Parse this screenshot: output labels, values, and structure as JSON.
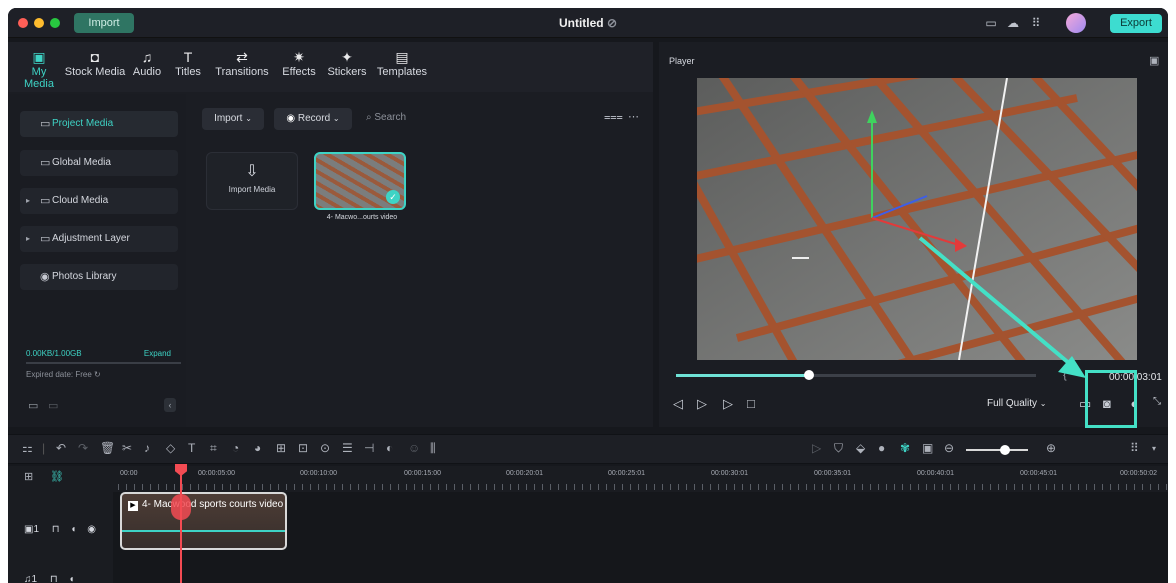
{
  "window": {
    "import_label": "Import",
    "title": "Untitled",
    "export_label": "Export"
  },
  "categories": [
    {
      "label": "My Media",
      "icon": "media-icon",
      "glyph": "▣"
    },
    {
      "label": "Stock Media",
      "icon": "stock-media-icon",
      "glyph": "◘"
    },
    {
      "label": "Audio",
      "icon": "audio-icon",
      "glyph": "♫"
    },
    {
      "label": "Titles",
      "icon": "titles-icon",
      "glyph": "T"
    },
    {
      "label": "Transitions",
      "icon": "transitions-icon",
      "glyph": "⇄"
    },
    {
      "label": "Effects",
      "icon": "effects-icon",
      "glyph": "✷"
    },
    {
      "label": "Stickers",
      "icon": "stickers-icon",
      "glyph": "✦"
    },
    {
      "label": "Templates",
      "icon": "templates-icon",
      "glyph": "▤"
    }
  ],
  "sidebar": {
    "items": [
      {
        "label": "Project Media",
        "active": true
      },
      {
        "label": "Global Media"
      },
      {
        "label": "Cloud Media"
      },
      {
        "label": "Adjustment Layer"
      },
      {
        "label": "Photos Library"
      }
    ],
    "storage": "0.00KB/1.00GB",
    "expand": "Expand",
    "expired": "Expired date: Free"
  },
  "media_toolbar": {
    "import": "Import",
    "record": "Record",
    "search_placeholder": "Search"
  },
  "media": {
    "import_tile": "Import Media",
    "clip_name": "4- Macwo...ourts video"
  },
  "player": {
    "label": "Player",
    "timecode": "00:00:03:01",
    "quality": "Full Quality",
    "progress": 0.37
  },
  "timeline": {
    "ruler": [
      "00:00",
      "00:00:05:00",
      "00:00:10:00",
      "00:00:15:00",
      "00:00:20:01",
      "00:00:25:01",
      "00:00:30:01",
      "00:00:35:01",
      "00:00:40:01",
      "00:00:45:01",
      "00:00:50:02"
    ],
    "clip_label": "4- Macwood sports courts video",
    "track1": "1",
    "track2": "1"
  },
  "colors": {
    "accent": "#3ed3c5",
    "playhead": "#f34b53",
    "highlight": "#44e0c6"
  }
}
